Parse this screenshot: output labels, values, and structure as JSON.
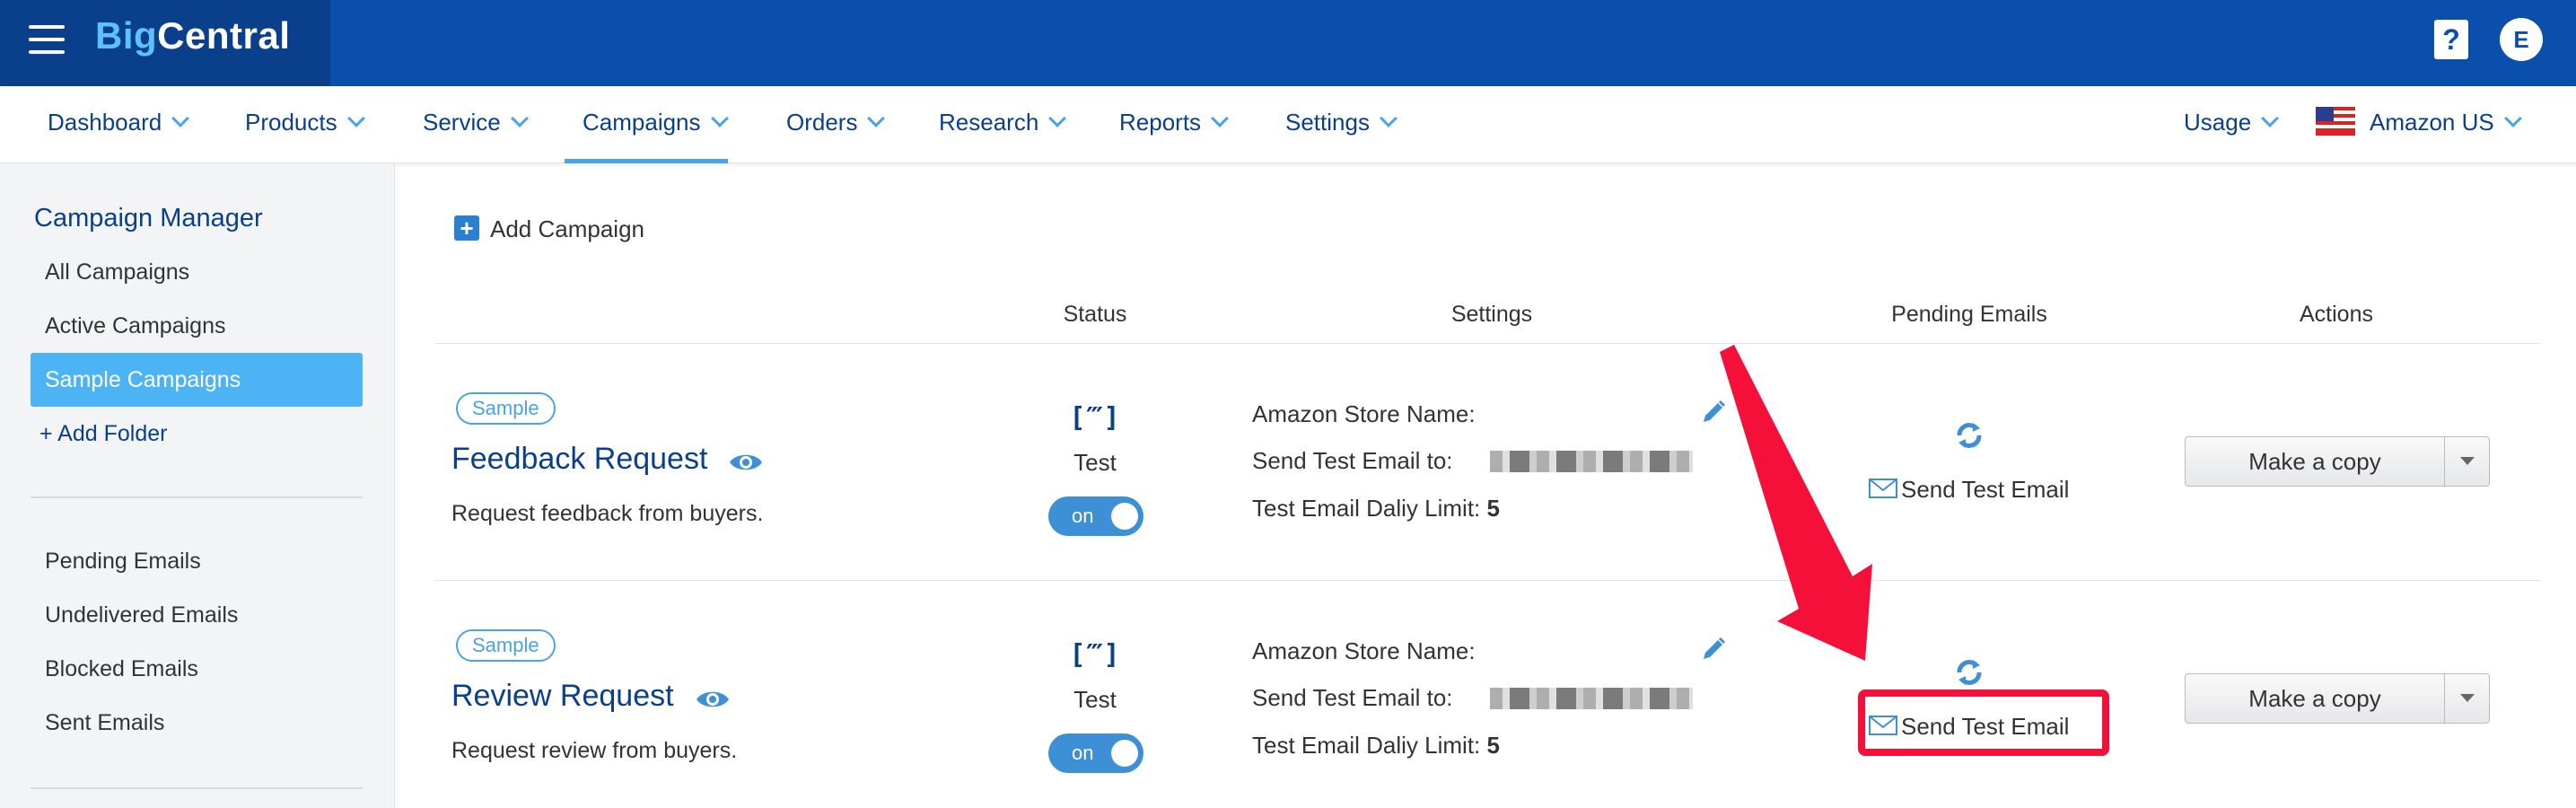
{
  "topbar": {
    "logo_big": "Big",
    "logo_central": "Central",
    "help_icon": "?",
    "avatar_initial": "E"
  },
  "nav": {
    "items": [
      {
        "label": "Dashboard"
      },
      {
        "label": "Products"
      },
      {
        "label": "Service"
      },
      {
        "label": "Campaigns",
        "active": true
      },
      {
        "label": "Orders"
      },
      {
        "label": "Research"
      },
      {
        "label": "Reports"
      },
      {
        "label": "Settings"
      }
    ],
    "usage_label": "Usage",
    "marketplace_label": "Amazon US",
    "marketplace_flag": "us-flag-icon"
  },
  "sidebar": {
    "title": "Campaign Manager",
    "items": [
      {
        "label": "All Campaigns"
      },
      {
        "label": "Active Campaigns"
      },
      {
        "label": "Sample Campaigns",
        "selected": true
      },
      {
        "label": "+ Add Folder"
      }
    ],
    "email_items": [
      {
        "label": "Pending Emails"
      },
      {
        "label": "Undelivered Emails"
      },
      {
        "label": "Blocked Emails"
      },
      {
        "label": "Sent Emails"
      }
    ]
  },
  "main": {
    "add_campaign_label": "Add Campaign",
    "columns": {
      "status": "Status",
      "settings": "Settings",
      "pending": "Pending Emails",
      "actions": "Actions"
    },
    "campaigns": [
      {
        "badge": "Sample",
        "name": "Feedback Request",
        "description": "Request feedback from buyers.",
        "status_icon": "[‴]",
        "status_text": "Test",
        "toggle_label": "on",
        "store_name_label": "Amazon Store Name:",
        "send_test_to_label": "Send Test Email to:",
        "limit_label": "Test Email Daliy Limit:",
        "limit_value": "5",
        "send_test_label": "Send Test Email",
        "copy_label": "Make a copy"
      },
      {
        "badge": "Sample",
        "name": "Review Request",
        "description": "Request review from buyers.",
        "status_icon": "[‴]",
        "status_text": "Test",
        "toggle_label": "on",
        "store_name_label": "Amazon Store Name:",
        "send_test_to_label": "Send Test Email to:",
        "limit_label": "Test Email Daliy Limit:",
        "limit_value": "5",
        "send_test_label": "Send Test Email",
        "copy_label": "Make a copy"
      }
    ]
  },
  "annotation": {
    "arrow_color": "#f5103a",
    "highlight_color": "#f5103a"
  }
}
